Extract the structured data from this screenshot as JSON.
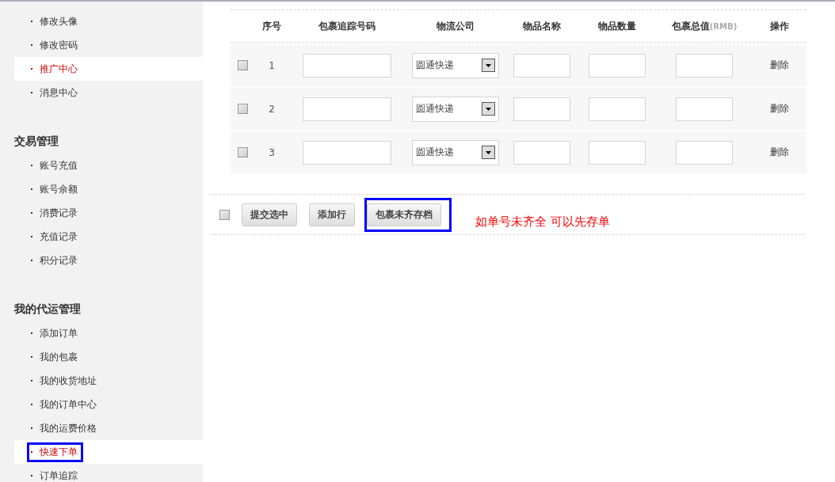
{
  "sidebar": {
    "groups": [
      {
        "items": [
          {
            "label": "修改头像",
            "selected": false,
            "annotated": false
          },
          {
            "label": "修改密码",
            "selected": false,
            "annotated": false
          },
          {
            "label": "推广中心",
            "selected": true,
            "annotated": false
          },
          {
            "label": "消息中心",
            "selected": false,
            "annotated": false
          }
        ]
      },
      {
        "heading": "交易管理",
        "items": [
          {
            "label": "账号充值",
            "selected": false,
            "annotated": false
          },
          {
            "label": "账号余额",
            "selected": false,
            "annotated": false
          },
          {
            "label": "消费记录",
            "selected": false,
            "annotated": false
          },
          {
            "label": "充值记录",
            "selected": false,
            "annotated": false
          },
          {
            "label": "积分记录",
            "selected": false,
            "annotated": false
          }
        ]
      },
      {
        "heading": "我的代运管理",
        "items": [
          {
            "label": "添加订单",
            "selected": false,
            "annotated": false
          },
          {
            "label": "我的包裹",
            "selected": false,
            "annotated": false
          },
          {
            "label": "我的收货地址",
            "selected": false,
            "annotated": false
          },
          {
            "label": "我的订单中心",
            "selected": false,
            "annotated": false
          },
          {
            "label": "我的运费价格",
            "selected": false,
            "annotated": false
          },
          {
            "label": "快速下单",
            "selected": true,
            "annotated": true
          },
          {
            "label": "订单追踪",
            "selected": false,
            "annotated": false
          }
        ]
      }
    ]
  },
  "table": {
    "columns": [
      {
        "label": "序号"
      },
      {
        "label": "包裹追踪号码"
      },
      {
        "label": "物流公司"
      },
      {
        "label": "物品名称"
      },
      {
        "label": "物品数量"
      },
      {
        "label": "包裹总值",
        "unit": "(RMB)"
      },
      {
        "label": "操作"
      }
    ],
    "rows": [
      {
        "checked": false,
        "index": "1",
        "carrier": "圆通快递",
        "action": "删除"
      },
      {
        "checked": false,
        "index": "2",
        "carrier": "圆通快递",
        "action": "删除"
      },
      {
        "checked": false,
        "index": "3",
        "carrier": "圆通快递",
        "action": "删除"
      }
    ]
  },
  "actions": {
    "select_all_checked": false,
    "buttons": [
      {
        "label": "提交选中",
        "annotated": false
      },
      {
        "label": "添加行",
        "annotated": false
      },
      {
        "label": "包裹未齐存档",
        "annotated": true
      }
    ],
    "note": "如单号未齐全 可以先存单"
  }
}
